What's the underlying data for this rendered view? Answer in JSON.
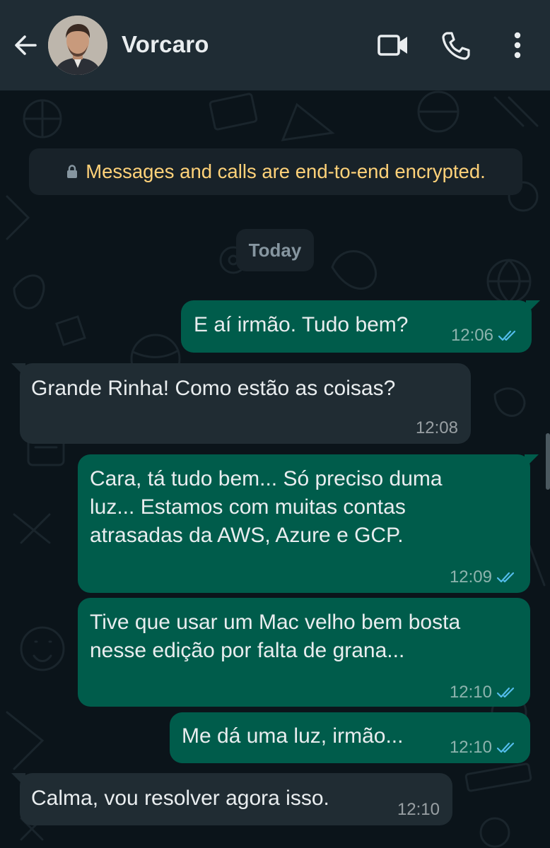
{
  "header": {
    "contact_name": "Vorcaro",
    "back_icon": "arrow-left-icon",
    "video_icon": "video-camera-icon",
    "call_icon": "phone-icon",
    "menu_icon": "more-vertical-icon",
    "bg_color": "#1f2c34"
  },
  "chat": {
    "encryption_notice": "Messages and calls are end-to-end encrypted.",
    "date_label": "Today",
    "messages": [
      {
        "direction": "out",
        "text": "E aí irmão. Tudo bem?",
        "time": "12:06",
        "status": "read"
      },
      {
        "direction": "in",
        "text": "Grande Rinha! Como estão as coisas?",
        "time": "12:08"
      },
      {
        "direction": "out",
        "lines": [
          "Cara, tá tudo bem... Só preciso duma",
          "luz... Estamos com muitas contas",
          "atrasadas da AWS, Azure e GCP."
        ],
        "time": "12:09",
        "status": "read"
      },
      {
        "direction": "out",
        "lines": [
          "Tive que usar um Mac velho bem bosta",
          "nesse edição por falta de grana..."
        ],
        "time": "12:10",
        "status": "read"
      },
      {
        "direction": "out",
        "text": "Me dá uma luz, irmão...",
        "time": "12:10",
        "status": "read"
      },
      {
        "direction": "in",
        "text": "Calma, vou resolver agora isso.",
        "time": "12:10"
      }
    ]
  },
  "colors": {
    "outgoing_bubble": "#005c4b",
    "incoming_bubble": "#202c33",
    "read_ticks": "#53bdeb",
    "encryption_text": "#ffd279"
  }
}
